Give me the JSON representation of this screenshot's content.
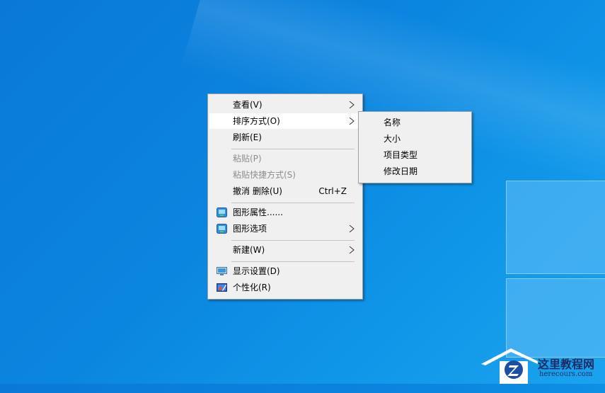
{
  "context_menu": {
    "items": [
      {
        "label": "查看(V)"
      },
      {
        "label": "排序方式(O)"
      },
      {
        "label": "刷新(E)"
      },
      {
        "label": "粘贴(P)"
      },
      {
        "label": "粘贴快捷方式(S)"
      },
      {
        "label": "撤消 删除(U)",
        "shortcut": "Ctrl+Z"
      },
      {
        "label": "图形属性......"
      },
      {
        "label": "图形选项"
      },
      {
        "label": "新建(W)"
      },
      {
        "label": "显示设置(D)"
      },
      {
        "label": "个性化(R)"
      }
    ]
  },
  "sort_submenu": {
    "items": [
      {
        "label": "名称"
      },
      {
        "label": "大小"
      },
      {
        "label": "项目类型"
      },
      {
        "label": "修改日期"
      }
    ]
  },
  "watermark": {
    "title": "这里教程网",
    "url": "herecours.com"
  },
  "colors": {
    "desktop": "#0b86e0",
    "menu_bg": "#f0f0f0",
    "disabled_text": "#8d8d8d",
    "highlight": "#ffffff"
  }
}
